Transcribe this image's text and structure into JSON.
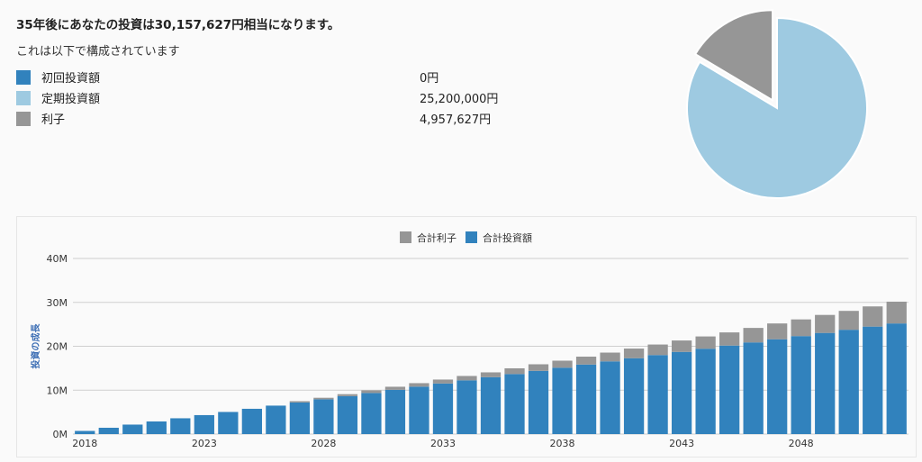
{
  "summary": {
    "headline": "35年後にあなたの投資は30,157,627円相当になります。",
    "subline": "これは以下で構成されています"
  },
  "breakdown": [
    {
      "label": "初回投資額",
      "value": "0円",
      "color": "#3182bd"
    },
    {
      "label": "定期投資額",
      "value": "25,200,000円",
      "color": "#9ecae1"
    },
    {
      "label": "利子",
      "value": "4,957,627円",
      "color": "#969696"
    }
  ],
  "chart_data": [
    {
      "type": "pie",
      "slices": [
        {
          "label": "初回投資額",
          "value": 0,
          "color": "#3182bd"
        },
        {
          "label": "定期投資額",
          "value": 25200000,
          "color": "#9ecae1"
        },
        {
          "label": "利子",
          "value": 4957627,
          "color": "#969696",
          "exploded": true
        }
      ]
    },
    {
      "type": "bar",
      "stacked": true,
      "ylabel": "投資の成長",
      "ylim": [
        0,
        40000000
      ],
      "yticks": [
        {
          "value": 0,
          "label": "0M"
        },
        {
          "value": 10000000,
          "label": "10M"
        },
        {
          "value": 20000000,
          "label": "20M"
        },
        {
          "value": 30000000,
          "label": "30M"
        },
        {
          "value": 40000000,
          "label": "40M"
        }
      ],
      "x_tick_labels": [
        {
          "year": 2018,
          "label": "2018"
        },
        {
          "year": 2023,
          "label": "2023"
        },
        {
          "year": 2028,
          "label": "2028"
        },
        {
          "year": 2033,
          "label": "2033"
        },
        {
          "year": 2038,
          "label": "2038"
        },
        {
          "year": 2043,
          "label": "2043"
        },
        {
          "year": 2048,
          "label": "2048"
        }
      ],
      "legend_position": "top-center",
      "categories": [
        2018,
        2019,
        2020,
        2021,
        2022,
        2023,
        2024,
        2025,
        2026,
        2027,
        2028,
        2029,
        2030,
        2031,
        2032,
        2033,
        2034,
        2035,
        2036,
        2037,
        2038,
        2039,
        2040,
        2041,
        2042,
        2043,
        2044,
        2045,
        2046,
        2047,
        2048,
        2049,
        2050,
        2051,
        2052
      ],
      "series": [
        {
          "name": "合計投資額",
          "color": "#3182bd",
          "values": [
            720000,
            1440000,
            2160000,
            2880000,
            3600000,
            4320000,
            5040000,
            5760000,
            6480000,
            7200000,
            7920000,
            8640000,
            9360000,
            10080000,
            10800000,
            11520000,
            12240000,
            12960000,
            13680000,
            14400000,
            15120000,
            15840000,
            16560000,
            17280000,
            18000000,
            18720000,
            19440000,
            20160000,
            20880000,
            21600000,
            22320000,
            23040000,
            23760000,
            24480000,
            25200000
          ]
        },
        {
          "name": "合計利子",
          "color": "#969696",
          "values": [
            0,
            0,
            0,
            0,
            0,
            0,
            0,
            0,
            0,
            300000,
            350000,
            450000,
            600000,
            700000,
            800000,
            900000,
            1000000,
            1100000,
            1300000,
            1500000,
            1600000,
            1800000,
            2000000,
            2200000,
            2400000,
            2600000,
            2800000,
            3000000,
            3300000,
            3600000,
            3800000,
            4100000,
            4300000,
            4600000,
            4957627
          ]
        }
      ]
    }
  ]
}
